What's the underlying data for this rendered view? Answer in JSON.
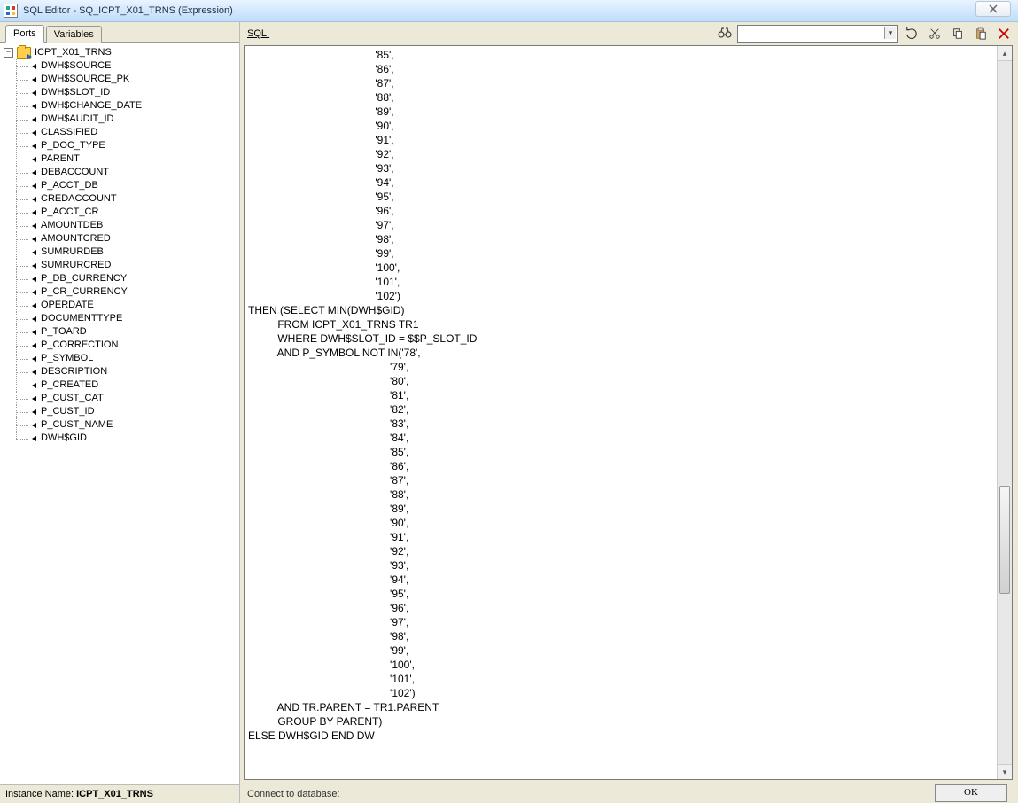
{
  "window": {
    "title": "SQL Editor - SQ_ICPT_X01_TRNS (Expression)",
    "title_ghost": "",
    "close_glyph": "✕"
  },
  "tabs": {
    "ports": "Ports",
    "variables": "Variables"
  },
  "tree": {
    "root": "ICPT_X01_TRNS",
    "toggle": "−",
    "ports": [
      "DWH$SOURCE",
      "DWH$SOURCE_PK",
      "DWH$SLOT_ID",
      "DWH$CHANGE_DATE",
      "DWH$AUDIT_ID",
      "CLASSIFIED",
      "P_DOC_TYPE",
      "PARENT",
      "DEBACCOUNT",
      "P_ACCT_DB",
      "CREDACCOUNT",
      "P_ACCT_CR",
      "AMOUNTDEB",
      "AMOUNTCRED",
      "SUMRURDEB",
      "SUMRURCRED",
      "P_DB_CURRENCY",
      "P_CR_CURRENCY",
      "OPERDATE",
      "DOCUMENTTYPE",
      "P_TOARD",
      "P_CORRECTION",
      "P_SYMBOL",
      "DESCRIPTION",
      "P_CREATED",
      "P_CUST_CAT",
      "P_CUST_ID",
      "P_CUST_NAME",
      "DWH$GID"
    ]
  },
  "instance": {
    "label": "Instance Name:",
    "value": "ICPT_X01_TRNS"
  },
  "sql": {
    "label": "SQL:",
    "find_placeholder": "",
    "content": "                                           '85',\n                                           '86',\n                                           '87',\n                                           '88',\n                                           '89',\n                                           '90',\n                                           '91',\n                                           '92',\n                                           '93',\n                                           '94',\n                                           '95',\n                                           '96',\n                                           '97',\n                                           '98',\n                                           '99',\n                                           '100',\n                                           '101',\n                                           '102')\nTHEN (SELECT MIN(DWH$GID)\n          FROM ICPT_X01_TRNS TR1\n          WHERE DWH$SLOT_ID = $$P_SLOT_ID\n          AND P_SYMBOL NOT IN('78',\n                                                '79',\n                                                '80',\n                                                '81',\n                                                '82',\n                                                '83',\n                                                '84',\n                                                '85',\n                                                '86',\n                                                '87',\n                                                '88',\n                                                '89',\n                                                '90',\n                                                '91',\n                                                '92',\n                                                '93',\n                                                '94',\n                                                '95',\n                                                '96',\n                                                '97',\n                                                '98',\n                                                '99',\n                                                '100',\n                                                '101',\n                                                '102')\n          AND TR.PARENT = TR1.PARENT\n          GROUP BY PARENT)\nELSE DWH$GID END DW"
  },
  "footer": {
    "connect_label": "Connect to database:",
    "ok": "OK"
  },
  "icons": {
    "binoculars": "🔍",
    "undo": "⟲"
  }
}
